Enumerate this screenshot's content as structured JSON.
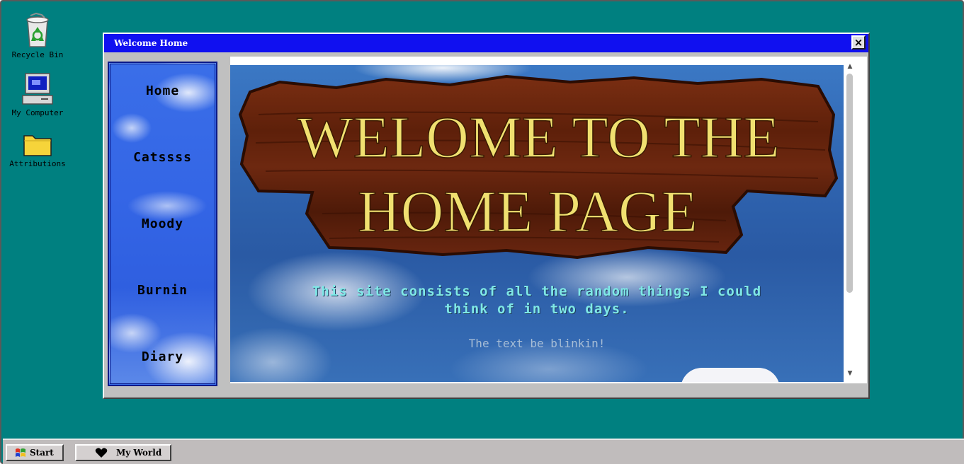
{
  "desktop": {
    "background": "#008080",
    "icons": [
      {
        "label": "Recycle Bin",
        "icon": "recycle-bin-icon"
      },
      {
        "label": "My Computer",
        "icon": "computer-icon"
      },
      {
        "label": "Attributions",
        "icon": "folder-icon"
      }
    ]
  },
  "window": {
    "title": "Welcome Home",
    "close_label": "×",
    "title_color": "#1010f0"
  },
  "sidebar": {
    "items": [
      {
        "label": "Home"
      },
      {
        "label": "Catssss"
      },
      {
        "label": "Moody"
      },
      {
        "label": "Burnin"
      },
      {
        "label": "Diary"
      }
    ]
  },
  "content": {
    "banner_line1": "WELOME TO THE",
    "banner_line2": "HOME PAGE",
    "tagline_line1": "This site consists of all the random things I could",
    "tagline_line2": "think of in two days.",
    "blink_text": "The text be blinkin!",
    "tagline_color": "#7fe8e6",
    "banner_text_color": "#f0e070"
  },
  "taskbar": {
    "start_label": "Start",
    "tasks": [
      {
        "label": "My World",
        "icon": "heart-icon"
      }
    ]
  }
}
